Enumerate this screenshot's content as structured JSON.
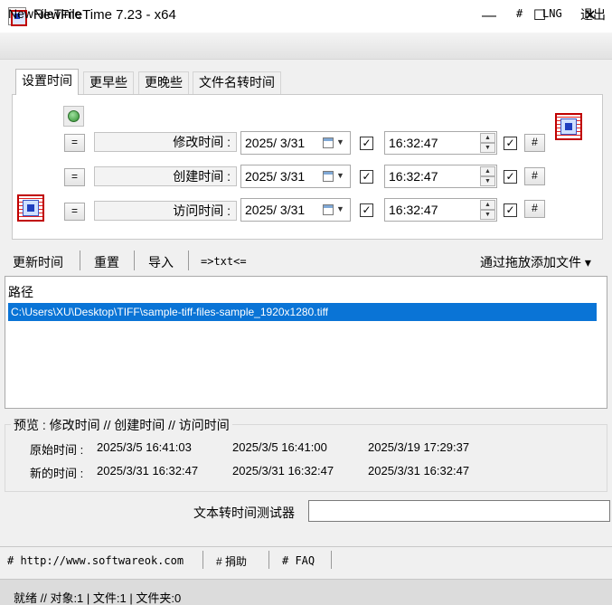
{
  "window": {
    "title": "NewFileTime 7.23 - x64",
    "minimize": "—",
    "maximize": "☐",
    "close": "✕"
  },
  "menubar": {
    "app": "NewFileTime",
    "hash": "#",
    "lng": "LNG",
    "exit": "退出"
  },
  "tabs": [
    "设置时间",
    "更早些",
    "更晚些",
    "文件名转时间"
  ],
  "rows": [
    {
      "eq": "=",
      "label": "修改时间 :",
      "date": "2025/ 3/31",
      "time": "16:32:47",
      "hash": "#"
    },
    {
      "eq": "=",
      "label": "创建时间 :",
      "date": "2025/ 3/31",
      "time": "16:32:47",
      "hash": "#"
    },
    {
      "eq": "=",
      "label": "访问时间 :",
      "date": "2025/ 3/31",
      "time": "16:32:47",
      "hash": "#"
    }
  ],
  "toolbar": {
    "update": "更新时间",
    "reset": "重置",
    "import": "导入",
    "txt": "=>txt<=",
    "drag_add": "通过拖放添加文件 ▾"
  },
  "filelist": {
    "header": "路径",
    "rows": [
      "C:\\Users\\XU\\Desktop\\TIFF\\sample-tiff-files-sample_1920x1280.tiff"
    ]
  },
  "preview": {
    "legend": "预览 :  修改时间  //  创建时间  //  访问时间",
    "original_label": "原始时间 :",
    "new_label": "新的时间 :",
    "original": [
      "2025/3/5 16:41:03",
      "2025/3/5 16:41:00",
      "2025/3/19 17:29:37"
    ],
    "new": [
      "2025/3/31 16:32:47",
      "2025/3/31 16:32:47",
      "2025/3/31 16:32:47"
    ]
  },
  "tester": {
    "label": "文本转时间测试器",
    "value": ""
  },
  "links": [
    "# http://www.softwareok.com",
    "# 捐助",
    "# FAQ"
  ],
  "status": "就绪 // 对象:1  | 文件:1   | 文件夹:0",
  "colors": {
    "selection": "#0a74d6",
    "icon_red": "#c00000"
  }
}
